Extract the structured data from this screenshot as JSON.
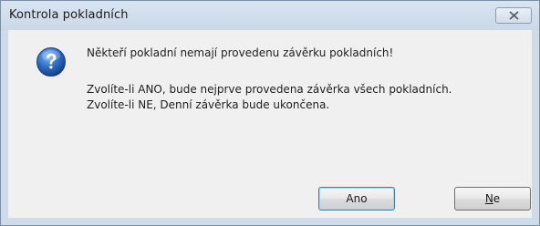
{
  "window": {
    "title": "Kontrola pokladních"
  },
  "message": {
    "line1": "Někteří pokladní nemají provedenu závěrku pokladních!",
    "line2": "Zvolíte-li ANO, bude nejprve provedena závěrka všech pokladních.",
    "line3": "Zvolíte-li NE, Denní závěrka bude ukončena."
  },
  "buttons": {
    "yes_label": "Ano",
    "no_mnemonic": "N",
    "no_rest": "e"
  },
  "icons": {
    "dialog_icon": "question-icon",
    "close": "close-icon"
  },
  "colors": {
    "title_bar": "#cad8e8",
    "dialog_background": "#f0f0f0",
    "default_button_border": "#3c7fb1",
    "icon_blue": "#1f5fb0"
  }
}
